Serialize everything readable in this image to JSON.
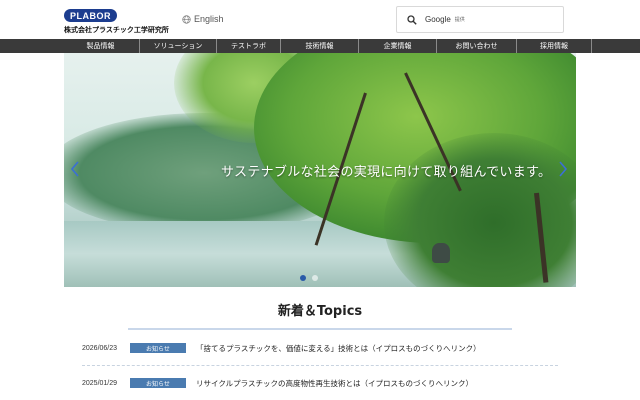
{
  "header": {
    "logo_text": "PLABOR",
    "company_name": "株式会社プラスチック工学研究所",
    "language_link": "English",
    "search": {
      "brand": "Google",
      "placeholder": "提供"
    }
  },
  "nav": {
    "items": [
      {
        "label": "製品情報"
      },
      {
        "label": "ソリューション"
      },
      {
        "label": "テストラボ"
      },
      {
        "label": "技術情報"
      },
      {
        "label": "企業情報"
      },
      {
        "label": "お問い合わせ"
      },
      {
        "label": "採用情報"
      }
    ]
  },
  "hero": {
    "caption": "サステナブルな社会の実現に向けて取り組んでいます。",
    "slide_count": 2,
    "active_slide": 1,
    "prev_icon": "chevron-left-icon",
    "next_icon": "chevron-right-icon"
  },
  "topics": {
    "heading": "新着＆Topics",
    "items": [
      {
        "date": "2026/06/23",
        "category": "お知らせ",
        "title": "「捨てるプラスチックを、価値に変える」技術とは（イプロスものづくりへリンク）"
      },
      {
        "date": "2025/01/29",
        "category": "お知らせ",
        "title": "リサイクルプラスチックの高度物性再生技術とは（イプロスものづくりへリンク）"
      }
    ]
  },
  "colors": {
    "brand_blue": "#1c3d8f",
    "nav_bg": "#3a3a3a",
    "badge_blue": "#4a7bb0"
  }
}
